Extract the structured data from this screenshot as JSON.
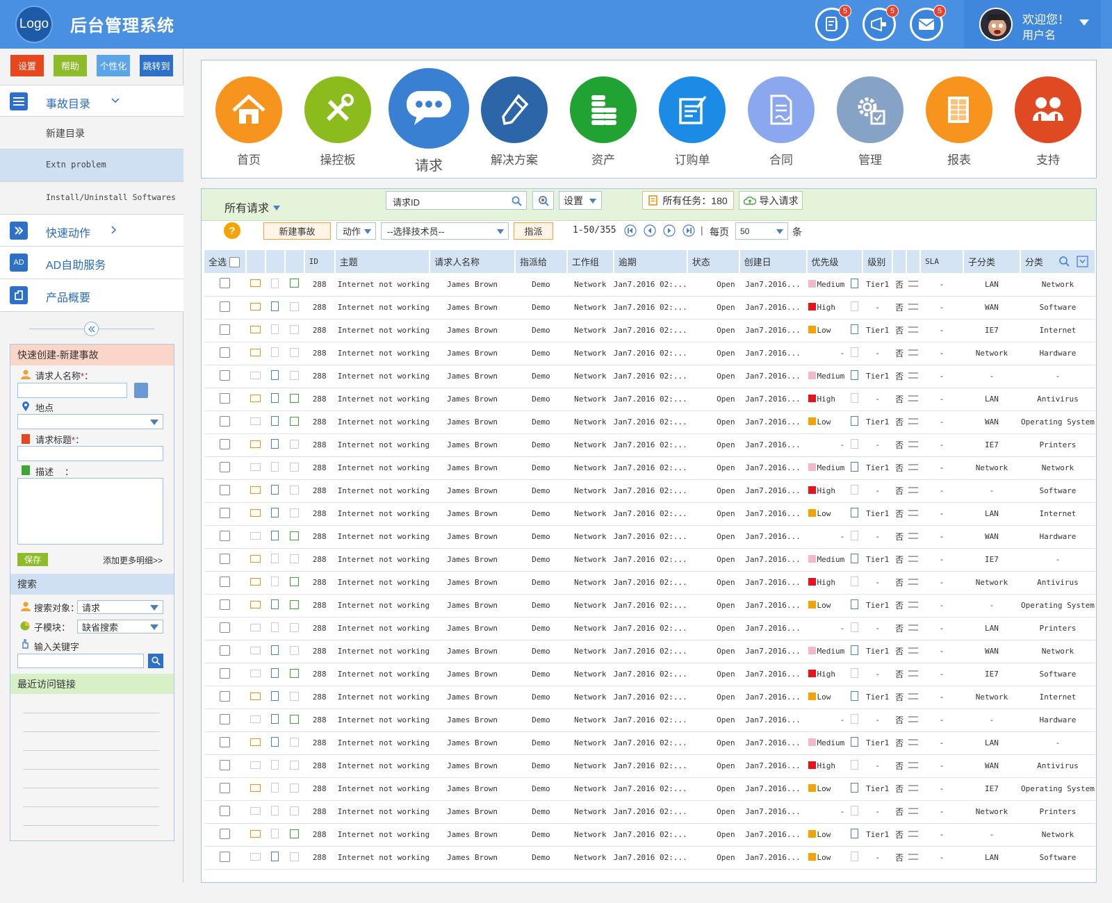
{
  "header": {
    "logo": "Logo",
    "title": "后台管理系统",
    "badges": [
      "5",
      "5",
      "5"
    ],
    "welcome": "欢迎您！",
    "username": "用户名"
  },
  "sidebar": {
    "top_buttons": [
      {
        "label": "设置",
        "color": "#e8471e"
      },
      {
        "label": "帮助",
        "color": "#8dbb2a"
      },
      {
        "label": "个性化",
        "color": "#5aa4ea"
      },
      {
        "label": "跳转到",
        "color": "#2c70c9"
      }
    ],
    "incident_catalog": "事故目录",
    "sub_items": [
      "新建目录",
      "Extn problem",
      "Install/Uninstall Softwares"
    ],
    "quick_actions": "快速动作",
    "ad_icon": "AD",
    "ad_service": "AD自助服务",
    "product_overview": "产品概要",
    "quick_create": {
      "title": "快速创建-新建事故",
      "requester_label": "请求人名称",
      "location_label": "地点",
      "subject_label": "请求标题",
      "desc_label": "描述",
      "desc_colon": "：",
      "required_mark": "*",
      "colon": "：",
      "save": "保存",
      "more": "添加更多明细>>"
    },
    "search": {
      "title": "搜索",
      "target_label": "搜索对象：",
      "target_value": "请求",
      "module_label": "子模块：",
      "module_value": "缺省搜索",
      "keyword_label": "输入关键字"
    },
    "recent": {
      "title": "最近访问链接"
    }
  },
  "modules": [
    {
      "label": "首页",
      "color": "#f7941d",
      "icon": "home-icon"
    },
    {
      "label": "操控板",
      "color": "#8cbb1e",
      "icon": "tools-icon"
    },
    {
      "label": "请求",
      "color": "#3a80d2",
      "icon": "chat-icon"
    },
    {
      "label": "解决方案",
      "color": "#2d66a8",
      "icon": "pencil-icon"
    },
    {
      "label": "资产",
      "color": "#21a334",
      "icon": "coins-icon"
    },
    {
      "label": "订购单",
      "color": "#1b8be6",
      "icon": "order-icon"
    },
    {
      "label": "合同",
      "color": "#8ba8ee",
      "icon": "contract-icon"
    },
    {
      "label": "管理",
      "color": "#86a2c4",
      "icon": "gear-icon"
    },
    {
      "label": "报表",
      "color": "#f7941d",
      "icon": "report-icon"
    },
    {
      "label": "支持",
      "color": "#e04a22",
      "icon": "support-icon"
    }
  ],
  "toolbar": {
    "all_requests": "所有请求",
    "search_placeholder": "请求ID",
    "settings": "设置",
    "all_tasks": "所有任务：180",
    "import": "导入请求",
    "new_incident": "新建事故",
    "action": "动作",
    "technician_placeholder": "--选择技术员--",
    "assign": "指派",
    "range": "1-50/355",
    "separator": "|",
    "per_page": "每页",
    "per_page_value": "50",
    "unit": "条"
  },
  "table": {
    "columns": [
      "全选",
      "ID",
      "主题",
      "请求人名称",
      "指派给",
      "工作组",
      "逾期",
      "状态",
      "创建日",
      "优先级",
      "级别",
      "SLA",
      "子分类",
      "分类"
    ],
    "priority_colors": {
      "Medium": "#f4b8c8",
      "High": "#e8131b",
      "Low": "#f5a300"
    },
    "rows": [
      {
        "id": "288",
        "subject": "Internet not working",
        "requester": "James Brown",
        "assignee": "Demo",
        "group": "Network",
        "due": "Jan7.2016 02:...",
        "status": "Open",
        "created": "Jan7.2016...",
        "priority": "Medium",
        "level": "Tier1",
        "no": "否",
        "sla": "-",
        "subcat": "LAN",
        "cat": "Network"
      },
      {
        "id": "288",
        "subject": "Internet not working",
        "requester": "James Brown",
        "assignee": "Demo",
        "group": "Network",
        "due": "Jan7.2016 02:...",
        "status": "Open",
        "created": "Jan7.2016...",
        "priority": "High",
        "level": "-",
        "no": "否",
        "sla": "-",
        "subcat": "WAN",
        "cat": "Software"
      },
      {
        "id": "288",
        "subject": "Internet not working",
        "requester": "James Brown",
        "assignee": "Demo",
        "group": "Network",
        "due": "Jan7.2016 02:...",
        "status": "Open",
        "created": "Jan7.2016...",
        "priority": "Low",
        "level": "Tier1",
        "no": "否",
        "sla": "-",
        "subcat": "IE7",
        "cat": "Internet"
      },
      {
        "id": "288",
        "subject": "Internet not working",
        "requester": "James Brown",
        "assignee": "Demo",
        "group": "Network",
        "due": "Jan7.2016 02:...",
        "status": "Open",
        "created": "Jan7.2016...",
        "priority": "-",
        "level": "-",
        "no": "否",
        "sla": "-",
        "subcat": "Network",
        "cat": "Hardware"
      },
      {
        "id": "288",
        "subject": "Internet not working",
        "requester": "James Brown",
        "assignee": "Demo",
        "group": "Network",
        "due": "Jan7.2016 02:...",
        "status": "Open",
        "created": "Jan7.2016...",
        "priority": "Medium",
        "level": "Tier1",
        "no": "否",
        "sla": "-",
        "subcat": "-",
        "cat": "-"
      },
      {
        "id": "288",
        "subject": "Internet not working",
        "requester": "James Brown",
        "assignee": "Demo",
        "group": "Network",
        "due": "Jan7.2016 02:...",
        "status": "Open",
        "created": "Jan7.2016...",
        "priority": "High",
        "level": "-",
        "no": "否",
        "sla": "-",
        "subcat": "LAN",
        "cat": "Antivirus"
      },
      {
        "id": "288",
        "subject": "Internet not working",
        "requester": "James Brown",
        "assignee": "Demo",
        "group": "Network",
        "due": "Jan7.2016 02:...",
        "status": "Open",
        "created": "Jan7.2016...",
        "priority": "Low",
        "level": "Tier1",
        "no": "否",
        "sla": "-",
        "subcat": "WAN",
        "cat": "Operating System"
      },
      {
        "id": "288",
        "subject": "Internet not working",
        "requester": "James Brown",
        "assignee": "Demo",
        "group": "Network",
        "due": "Jan7.2016 02:...",
        "status": "Open",
        "created": "Jan7.2016...",
        "priority": "-",
        "level": "-",
        "no": "否",
        "sla": "-",
        "subcat": "IE7",
        "cat": "Printers"
      },
      {
        "id": "288",
        "subject": "Internet not working",
        "requester": "James Brown",
        "assignee": "Demo",
        "group": "Network",
        "due": "Jan7.2016 02:...",
        "status": "Open",
        "created": "Jan7.2016...",
        "priority": "Medium",
        "level": "Tier1",
        "no": "否",
        "sla": "-",
        "subcat": "Network",
        "cat": "Network"
      },
      {
        "id": "288",
        "subject": "Internet not working",
        "requester": "James Brown",
        "assignee": "Demo",
        "group": "Network",
        "due": "Jan7.2016 02:...",
        "status": "Open",
        "created": "Jan7.2016...",
        "priority": "High",
        "level": "-",
        "no": "否",
        "sla": "-",
        "subcat": "-",
        "cat": "Software"
      },
      {
        "id": "288",
        "subject": "Internet not working",
        "requester": "James Brown",
        "assignee": "Demo",
        "group": "Network",
        "due": "Jan7.2016 02:...",
        "status": "Open",
        "created": "Jan7.2016...",
        "priority": "Low",
        "level": "Tier1",
        "no": "否",
        "sla": "-",
        "subcat": "LAN",
        "cat": "Internet"
      },
      {
        "id": "288",
        "subject": "Internet not working",
        "requester": "James Brown",
        "assignee": "Demo",
        "group": "Network",
        "due": "Jan7.2016 02:...",
        "status": "Open",
        "created": "Jan7.2016...",
        "priority": "-",
        "level": "-",
        "no": "否",
        "sla": "-",
        "subcat": "WAN",
        "cat": "Hardware"
      },
      {
        "id": "288",
        "subject": "Internet not working",
        "requester": "James Brown",
        "assignee": "Demo",
        "group": "Network",
        "due": "Jan7.2016 02:...",
        "status": "Open",
        "created": "Jan7.2016...",
        "priority": "Medium",
        "level": "Tier1",
        "no": "否",
        "sla": "-",
        "subcat": "IE7",
        "cat": "-"
      },
      {
        "id": "288",
        "subject": "Internet not working",
        "requester": "James Brown",
        "assignee": "Demo",
        "group": "Network",
        "due": "Jan7.2016 02:...",
        "status": "Open",
        "created": "Jan7.2016...",
        "priority": "High",
        "level": "-",
        "no": "否",
        "sla": "-",
        "subcat": "Network",
        "cat": "Antivirus"
      },
      {
        "id": "288",
        "subject": "Internet not working",
        "requester": "James Brown",
        "assignee": "Demo",
        "group": "Network",
        "due": "Jan7.2016 02:...",
        "status": "Open",
        "created": "Jan7.2016...",
        "priority": "Low",
        "level": "Tier1",
        "no": "否",
        "sla": "-",
        "subcat": "-",
        "cat": "Operating System"
      },
      {
        "id": "288",
        "subject": "Internet not working",
        "requester": "James Brown",
        "assignee": "Demo",
        "group": "Network",
        "due": "Jan7.2016 02:...",
        "status": "Open",
        "created": "Jan7.2016...",
        "priority": "-",
        "level": "-",
        "no": "否",
        "sla": "-",
        "subcat": "LAN",
        "cat": "Printers"
      },
      {
        "id": "288",
        "subject": "Internet not working",
        "requester": "James Brown",
        "assignee": "Demo",
        "group": "Network",
        "due": "Jan7.2016 02:...",
        "status": "Open",
        "created": "Jan7.2016...",
        "priority": "Medium",
        "level": "Tier1",
        "no": "否",
        "sla": "-",
        "subcat": "WAN",
        "cat": "Network"
      },
      {
        "id": "288",
        "subject": "Internet not working",
        "requester": "James Brown",
        "assignee": "Demo",
        "group": "Network",
        "due": "Jan7.2016 02:...",
        "status": "Open",
        "created": "Jan7.2016...",
        "priority": "High",
        "level": "-",
        "no": "否",
        "sla": "-",
        "subcat": "IE7",
        "cat": "Software"
      },
      {
        "id": "288",
        "subject": "Internet not working",
        "requester": "James Brown",
        "assignee": "Demo",
        "group": "Network",
        "due": "Jan7.2016 02:...",
        "status": "Open",
        "created": "Jan7.2016...",
        "priority": "Low",
        "level": "Tier1",
        "no": "否",
        "sla": "-",
        "subcat": "Network",
        "cat": "Internet"
      },
      {
        "id": "288",
        "subject": "Internet not working",
        "requester": "James Brown",
        "assignee": "Demo",
        "group": "Network",
        "due": "Jan7.2016 02:...",
        "status": "Open",
        "created": "Jan7.2016...",
        "priority": "-",
        "level": "-",
        "no": "否",
        "sla": "-",
        "subcat": "-",
        "cat": "Hardware"
      },
      {
        "id": "288",
        "subject": "Internet not working",
        "requester": "James Brown",
        "assignee": "Demo",
        "group": "Network",
        "due": "Jan7.2016 02:...",
        "status": "Open",
        "created": "Jan7.2016...",
        "priority": "Medium",
        "level": "Tier1",
        "no": "否",
        "sla": "-",
        "subcat": "LAN",
        "cat": "-"
      },
      {
        "id": "288",
        "subject": "Internet not working",
        "requester": "James Brown",
        "assignee": "Demo",
        "group": "Network",
        "due": "Jan7.2016 02:...",
        "status": "Open",
        "created": "Jan7.2016...",
        "priority": "High",
        "level": "-",
        "no": "否",
        "sla": "-",
        "subcat": "WAN",
        "cat": "Antivirus"
      },
      {
        "id": "288",
        "subject": "Internet not working",
        "requester": "James Brown",
        "assignee": "Demo",
        "group": "Network",
        "due": "Jan7.2016 02:...",
        "status": "Open",
        "created": "Jan7.2016...",
        "priority": "Low",
        "level": "Tier1",
        "no": "否",
        "sla": "-",
        "subcat": "IE7",
        "cat": "Operating System"
      },
      {
        "id": "288",
        "subject": "Internet not working",
        "requester": "James Brown",
        "assignee": "Demo",
        "group": "Network",
        "due": "Jan7.2016 02:...",
        "status": "Open",
        "created": "Jan7.2016...",
        "priority": "-",
        "level": "-",
        "no": "否",
        "sla": "-",
        "subcat": "Network",
        "cat": "Printers"
      },
      {
        "id": "288",
        "subject": "Internet not working",
        "requester": "James Brown",
        "assignee": "Demo",
        "group": "Network",
        "due": "Jan7.2016 02:...",
        "status": "Open",
        "created": "Jan7.2016...",
        "priority": "Low",
        "level": "Tier1",
        "no": "否",
        "sla": "-",
        "subcat": "-",
        "cat": "Network"
      },
      {
        "id": "288",
        "subject": "Internet not working",
        "requester": "James Brown",
        "assignee": "Demo",
        "group": "Network",
        "due": "Jan7.2016 02:...",
        "status": "Open",
        "created": "Jan7.2016...",
        "priority": "Low",
        "level": "-",
        "no": "否",
        "sla": "-",
        "subcat": "LAN",
        "cat": "Software"
      }
    ]
  }
}
